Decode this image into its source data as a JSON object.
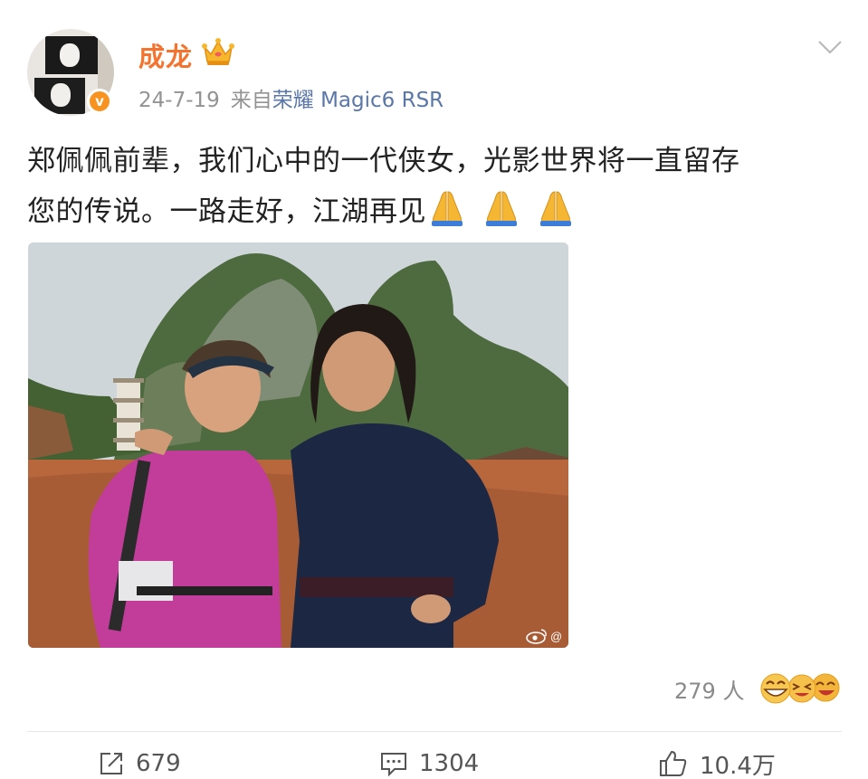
{
  "post": {
    "author": {
      "name": "成龙",
      "verified": true,
      "badge_icon": "crown-icon"
    },
    "timestamp": "24-7-19",
    "source_prefix": "来自",
    "source_device": "荣耀 Magic6 RSR",
    "content_line1": "郑佩佩前辈，我们心中的一代侠女，光影世界将一直留存",
    "content_line2": "您的传说。一路走好，江湖再见",
    "content_emojis": [
      "praying-hands-icon",
      "praying-hands-icon",
      "praying-hands-icon"
    ],
    "photo": {
      "watermark_icon": "weibo-logo-icon",
      "watermark_text": "@"
    },
    "reactions": {
      "count_label": "279 人",
      "emojis": [
        "grin-emoji",
        "squint-emoji",
        "laugh-emoji"
      ]
    },
    "actions": {
      "repost_count": "679",
      "comment_count": "1304",
      "like_count": "10.4万"
    }
  },
  "colors": {
    "username": "#f4732e",
    "verified_badge": "#f7931e",
    "device_link": "#5a77a8",
    "meta_gray": "#939393"
  }
}
